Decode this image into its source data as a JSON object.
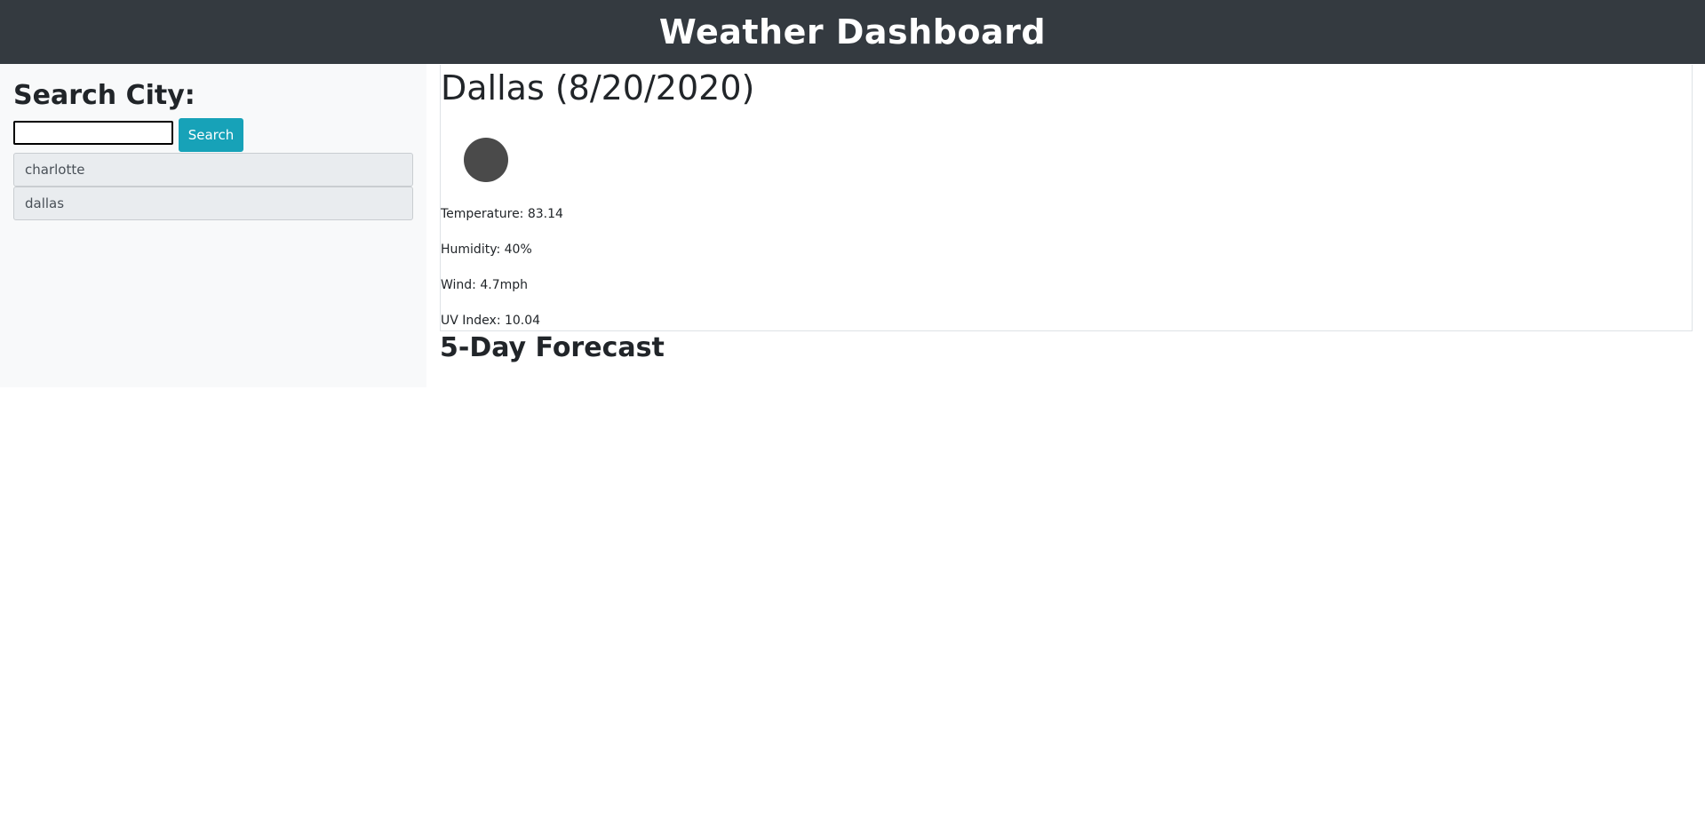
{
  "header": {
    "title": "Weather Dashboard"
  },
  "sidebar": {
    "title": "Search City:",
    "search": {
      "value": "",
      "placeholder": ""
    },
    "search_button_label": "Search",
    "history": [
      {
        "label": "charlotte"
      },
      {
        "label": "dallas"
      }
    ]
  },
  "current": {
    "city_title": "Dallas (8/20/2020)",
    "icon": "weather-icon",
    "temperature": "Temperature: 83.14",
    "humidity": "Humidity: 40%",
    "wind": "Wind: 4.7mph",
    "uv_index": "UV Index: 10.04"
  },
  "forecast": {
    "title": "5-Day Forecast"
  },
  "colors": {
    "header_bg": "#343a40",
    "sidebar_bg": "#f8f9fa",
    "button_bg": "#17a2b8",
    "history_bg": "#e9ecef"
  }
}
